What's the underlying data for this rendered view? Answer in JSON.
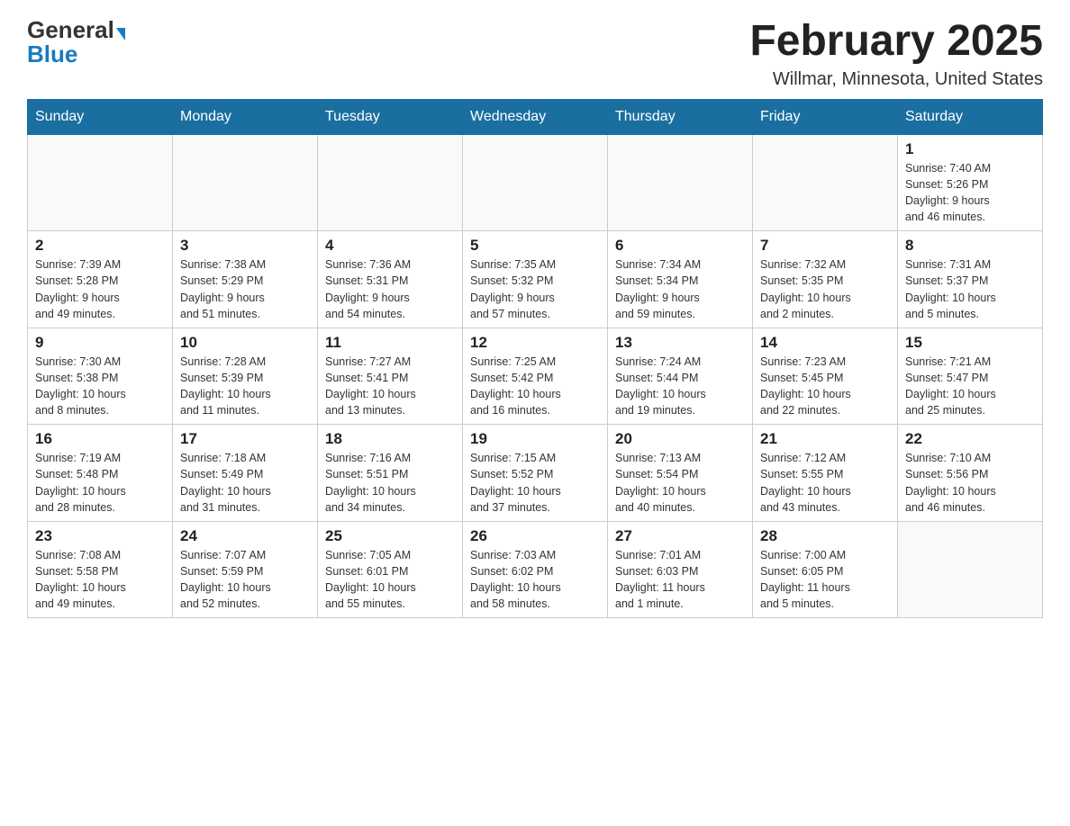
{
  "header": {
    "logo_general": "General",
    "logo_blue": "Blue",
    "month_title": "February 2025",
    "location": "Willmar, Minnesota, United States"
  },
  "weekdays": [
    "Sunday",
    "Monday",
    "Tuesday",
    "Wednesday",
    "Thursday",
    "Friday",
    "Saturday"
  ],
  "weeks": [
    [
      {
        "day": "",
        "info": ""
      },
      {
        "day": "",
        "info": ""
      },
      {
        "day": "",
        "info": ""
      },
      {
        "day": "",
        "info": ""
      },
      {
        "day": "",
        "info": ""
      },
      {
        "day": "",
        "info": ""
      },
      {
        "day": "1",
        "info": "Sunrise: 7:40 AM\nSunset: 5:26 PM\nDaylight: 9 hours\nand 46 minutes."
      }
    ],
    [
      {
        "day": "2",
        "info": "Sunrise: 7:39 AM\nSunset: 5:28 PM\nDaylight: 9 hours\nand 49 minutes."
      },
      {
        "day": "3",
        "info": "Sunrise: 7:38 AM\nSunset: 5:29 PM\nDaylight: 9 hours\nand 51 minutes."
      },
      {
        "day": "4",
        "info": "Sunrise: 7:36 AM\nSunset: 5:31 PM\nDaylight: 9 hours\nand 54 minutes."
      },
      {
        "day": "5",
        "info": "Sunrise: 7:35 AM\nSunset: 5:32 PM\nDaylight: 9 hours\nand 57 minutes."
      },
      {
        "day": "6",
        "info": "Sunrise: 7:34 AM\nSunset: 5:34 PM\nDaylight: 9 hours\nand 59 minutes."
      },
      {
        "day": "7",
        "info": "Sunrise: 7:32 AM\nSunset: 5:35 PM\nDaylight: 10 hours\nand 2 minutes."
      },
      {
        "day": "8",
        "info": "Sunrise: 7:31 AM\nSunset: 5:37 PM\nDaylight: 10 hours\nand 5 minutes."
      }
    ],
    [
      {
        "day": "9",
        "info": "Sunrise: 7:30 AM\nSunset: 5:38 PM\nDaylight: 10 hours\nand 8 minutes."
      },
      {
        "day": "10",
        "info": "Sunrise: 7:28 AM\nSunset: 5:39 PM\nDaylight: 10 hours\nand 11 minutes."
      },
      {
        "day": "11",
        "info": "Sunrise: 7:27 AM\nSunset: 5:41 PM\nDaylight: 10 hours\nand 13 minutes."
      },
      {
        "day": "12",
        "info": "Sunrise: 7:25 AM\nSunset: 5:42 PM\nDaylight: 10 hours\nand 16 minutes."
      },
      {
        "day": "13",
        "info": "Sunrise: 7:24 AM\nSunset: 5:44 PM\nDaylight: 10 hours\nand 19 minutes."
      },
      {
        "day": "14",
        "info": "Sunrise: 7:23 AM\nSunset: 5:45 PM\nDaylight: 10 hours\nand 22 minutes."
      },
      {
        "day": "15",
        "info": "Sunrise: 7:21 AM\nSunset: 5:47 PM\nDaylight: 10 hours\nand 25 minutes."
      }
    ],
    [
      {
        "day": "16",
        "info": "Sunrise: 7:19 AM\nSunset: 5:48 PM\nDaylight: 10 hours\nand 28 minutes."
      },
      {
        "day": "17",
        "info": "Sunrise: 7:18 AM\nSunset: 5:49 PM\nDaylight: 10 hours\nand 31 minutes."
      },
      {
        "day": "18",
        "info": "Sunrise: 7:16 AM\nSunset: 5:51 PM\nDaylight: 10 hours\nand 34 minutes."
      },
      {
        "day": "19",
        "info": "Sunrise: 7:15 AM\nSunset: 5:52 PM\nDaylight: 10 hours\nand 37 minutes."
      },
      {
        "day": "20",
        "info": "Sunrise: 7:13 AM\nSunset: 5:54 PM\nDaylight: 10 hours\nand 40 minutes."
      },
      {
        "day": "21",
        "info": "Sunrise: 7:12 AM\nSunset: 5:55 PM\nDaylight: 10 hours\nand 43 minutes."
      },
      {
        "day": "22",
        "info": "Sunrise: 7:10 AM\nSunset: 5:56 PM\nDaylight: 10 hours\nand 46 minutes."
      }
    ],
    [
      {
        "day": "23",
        "info": "Sunrise: 7:08 AM\nSunset: 5:58 PM\nDaylight: 10 hours\nand 49 minutes."
      },
      {
        "day": "24",
        "info": "Sunrise: 7:07 AM\nSunset: 5:59 PM\nDaylight: 10 hours\nand 52 minutes."
      },
      {
        "day": "25",
        "info": "Sunrise: 7:05 AM\nSunset: 6:01 PM\nDaylight: 10 hours\nand 55 minutes."
      },
      {
        "day": "26",
        "info": "Sunrise: 7:03 AM\nSunset: 6:02 PM\nDaylight: 10 hours\nand 58 minutes."
      },
      {
        "day": "27",
        "info": "Sunrise: 7:01 AM\nSunset: 6:03 PM\nDaylight: 11 hours\nand 1 minute."
      },
      {
        "day": "28",
        "info": "Sunrise: 7:00 AM\nSunset: 6:05 PM\nDaylight: 11 hours\nand 5 minutes."
      },
      {
        "day": "",
        "info": ""
      }
    ]
  ]
}
